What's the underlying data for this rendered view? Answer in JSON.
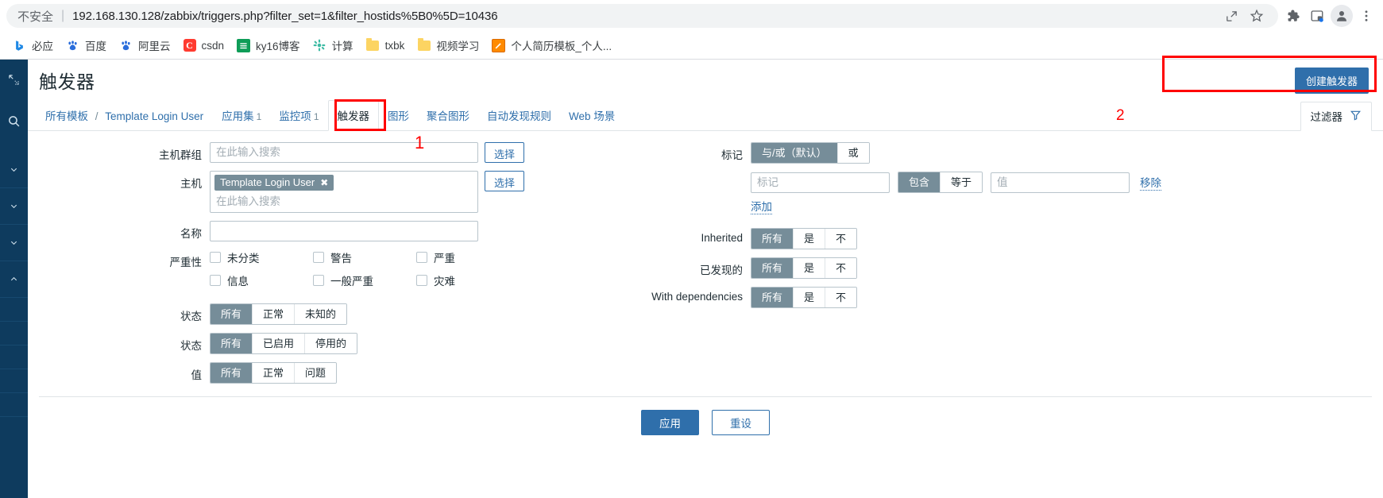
{
  "browser": {
    "security_label": "不安全",
    "url": "192.168.130.128/zabbix/triggers.php?filter_set=1&filter_hostids%5B0%5D=10436",
    "toolbar_icons": [
      "share-icon",
      "star-icon",
      "extensions-icon",
      "sidepanel-icon",
      "profile-icon",
      "menu-icon"
    ],
    "bookmarks": [
      {
        "label": "必应",
        "icon": "bing-icon"
      },
      {
        "label": "百度",
        "icon": "baidu-icon"
      },
      {
        "label": "阿里云",
        "icon": "aliyun-icon"
      },
      {
        "label": "csdn",
        "icon": "csdn-icon"
      },
      {
        "label": "ky16博客",
        "icon": "ky16-icon"
      },
      {
        "label": "计算",
        "icon": "calc-icon"
      },
      {
        "label": "txbk",
        "icon": "folder-icon"
      },
      {
        "label": "视频学习",
        "icon": "folder-icon"
      },
      {
        "label": "个人简历模板_个人...",
        "icon": "edit-icon"
      }
    ]
  },
  "page": {
    "title": "触发器",
    "create_button": "创建触发器",
    "filter_tab": "过滤器",
    "annotation_1": "1",
    "annotation_2": "2"
  },
  "nav": {
    "breadcrumb_root": "所有模板",
    "breadcrumb_sep": "/",
    "breadcrumb_current": "Template Login User",
    "tabs": [
      {
        "label": "应用集",
        "count": "1",
        "selected": false
      },
      {
        "label": "监控项",
        "count": "1",
        "selected": false
      },
      {
        "label": "触发器",
        "count": "",
        "selected": true
      },
      {
        "label": "图形",
        "count": "",
        "selected": false
      },
      {
        "label": "聚合图形",
        "count": "",
        "selected": false
      },
      {
        "label": "自动发现规则",
        "count": "",
        "selected": false
      },
      {
        "label": "Web 场景",
        "count": "",
        "selected": false
      }
    ]
  },
  "filter": {
    "hostgroup": {
      "label": "主机群组",
      "placeholder": "在此输入搜索",
      "value": "",
      "select_button": "选择"
    },
    "host": {
      "label": "主机",
      "placeholder": "在此输入搜索",
      "chips": [
        "Template Login User"
      ],
      "select_button": "选择"
    },
    "name": {
      "label": "名称",
      "value": "",
      "placeholder": ""
    },
    "severity": {
      "label": "严重性",
      "options": [
        {
          "label": "未分类",
          "checked": false
        },
        {
          "label": "警告",
          "checked": false
        },
        {
          "label": "严重",
          "checked": false
        },
        {
          "label": "信息",
          "checked": false
        },
        {
          "label": "一般严重",
          "checked": false
        },
        {
          "label": "灾难",
          "checked": false
        }
      ]
    },
    "state": {
      "label": "状态",
      "options": [
        "所有",
        "正常",
        "未知的"
      ],
      "selected": 0
    },
    "status": {
      "label": "状态",
      "options": [
        "所有",
        "已启用",
        "停用的"
      ],
      "selected": 0
    },
    "value": {
      "label": "值",
      "options": [
        "所有",
        "正常",
        "问题"
      ],
      "selected": 0
    },
    "tags": {
      "label": "标记",
      "evaltype_options": [
        "与/或（默认）",
        "或"
      ],
      "evaltype_selected": 0,
      "tag_placeholder": "标记",
      "tag_value": "",
      "operator_options": [
        "包含",
        "等于"
      ],
      "operator_selected": 0,
      "value_placeholder": "值",
      "value_value": "",
      "remove_link": "移除",
      "add_link": "添加"
    },
    "inherited": {
      "label": "Inherited",
      "options": [
        "所有",
        "是",
        "不"
      ],
      "selected": 0
    },
    "discovered": {
      "label": "已发现的",
      "options": [
        "所有",
        "是",
        "不"
      ],
      "selected": 0
    },
    "dependencies": {
      "label": "With dependencies",
      "options": [
        "所有",
        "是",
        "不"
      ],
      "selected": 0
    },
    "apply_button": "应用",
    "reset_button": "重设"
  },
  "colors": {
    "accent": "#2f6fab",
    "sidebar": "#0e3b5e",
    "segment_on": "#768d99",
    "annotation": "#ff0000"
  }
}
